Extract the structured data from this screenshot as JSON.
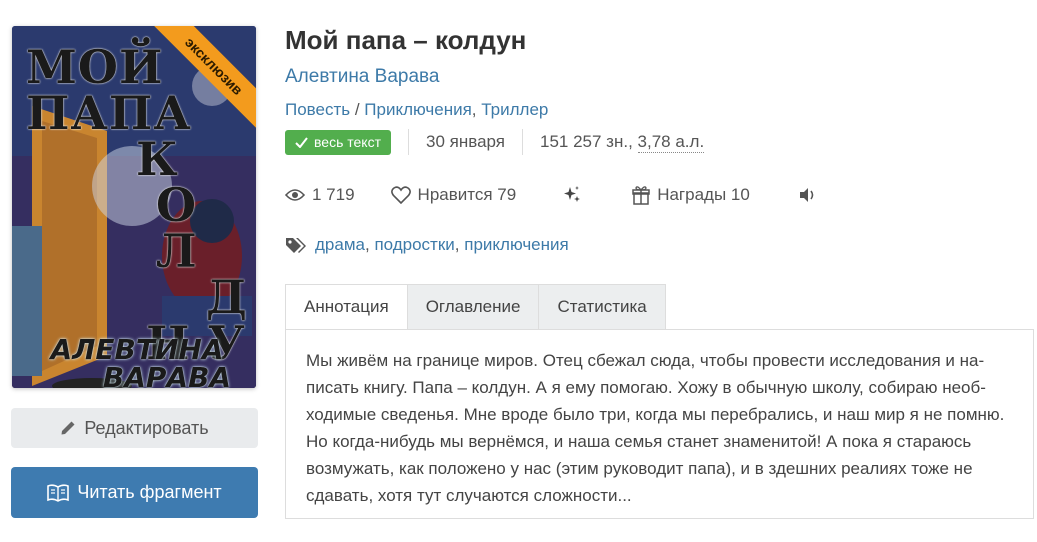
{
  "book": {
    "title": "Мой папа – колдун",
    "author": "Алевтина Варава",
    "genres": [
      "Повесть",
      "Приключения",
      "Триллер"
    ],
    "status_badge": "весь текст",
    "date": "30 января",
    "size_chars": "151 257 зн.,",
    "size_sheets": "3,78 а.л."
  },
  "cover": {
    "title_line1": "МОЙ ПАПА",
    "title_line2": "К",
    "title_line3": "О Л",
    "title_line4": "Д",
    "title_line5": "Н У",
    "author_line1": "АЛЕВТИНА",
    "author_line2": "ВАРАВА",
    "ribbon": "эксклюзив"
  },
  "stats": {
    "views": "1 719",
    "likes_label": "Нравится 79",
    "awards_label": "Награды 10"
  },
  "tags": [
    "драма",
    "подростки",
    "приключения"
  ],
  "buttons": {
    "edit": "Редактировать",
    "read": "Читать фрагмент"
  },
  "tabs": [
    {
      "label": "Аннотация",
      "active": true
    },
    {
      "label": "Оглавление",
      "active": false
    },
    {
      "label": "Статистика",
      "active": false
    }
  ],
  "annotation": "Мы живём на границе миров. Отец сбежал сюда, чтобы провести исследования и на­писать книгу. Папа – колдун. А я ему помогаю. Хожу в обычную школу, собираю необ­ходимые сведенья. Мне вроде было три, когда мы перебрались, и наш мир я не по­мню. Но когда-нибудь мы вернёмся, и наша семья станет знаменитой! А пока я стара­юсь возмужать, как положено у нас (этим руководит папа), и в здешних реалиях тоже не сдавать, хотя тут случаются сложности...",
  "icons": {
    "views": "eye-icon",
    "likes": "heart-icon",
    "sparkle": "sparkle-icon",
    "awards": "gift-icon",
    "audio": "speaker-icon",
    "tags": "tag-icon",
    "edit": "pencil-icon",
    "read": "book-icon",
    "badge": "check-icon"
  },
  "colors": {
    "link": "#3d7aa8",
    "badge_green": "#52ae4d",
    "read_button": "#3e7bb0",
    "ribbon": "#f39b1d"
  }
}
